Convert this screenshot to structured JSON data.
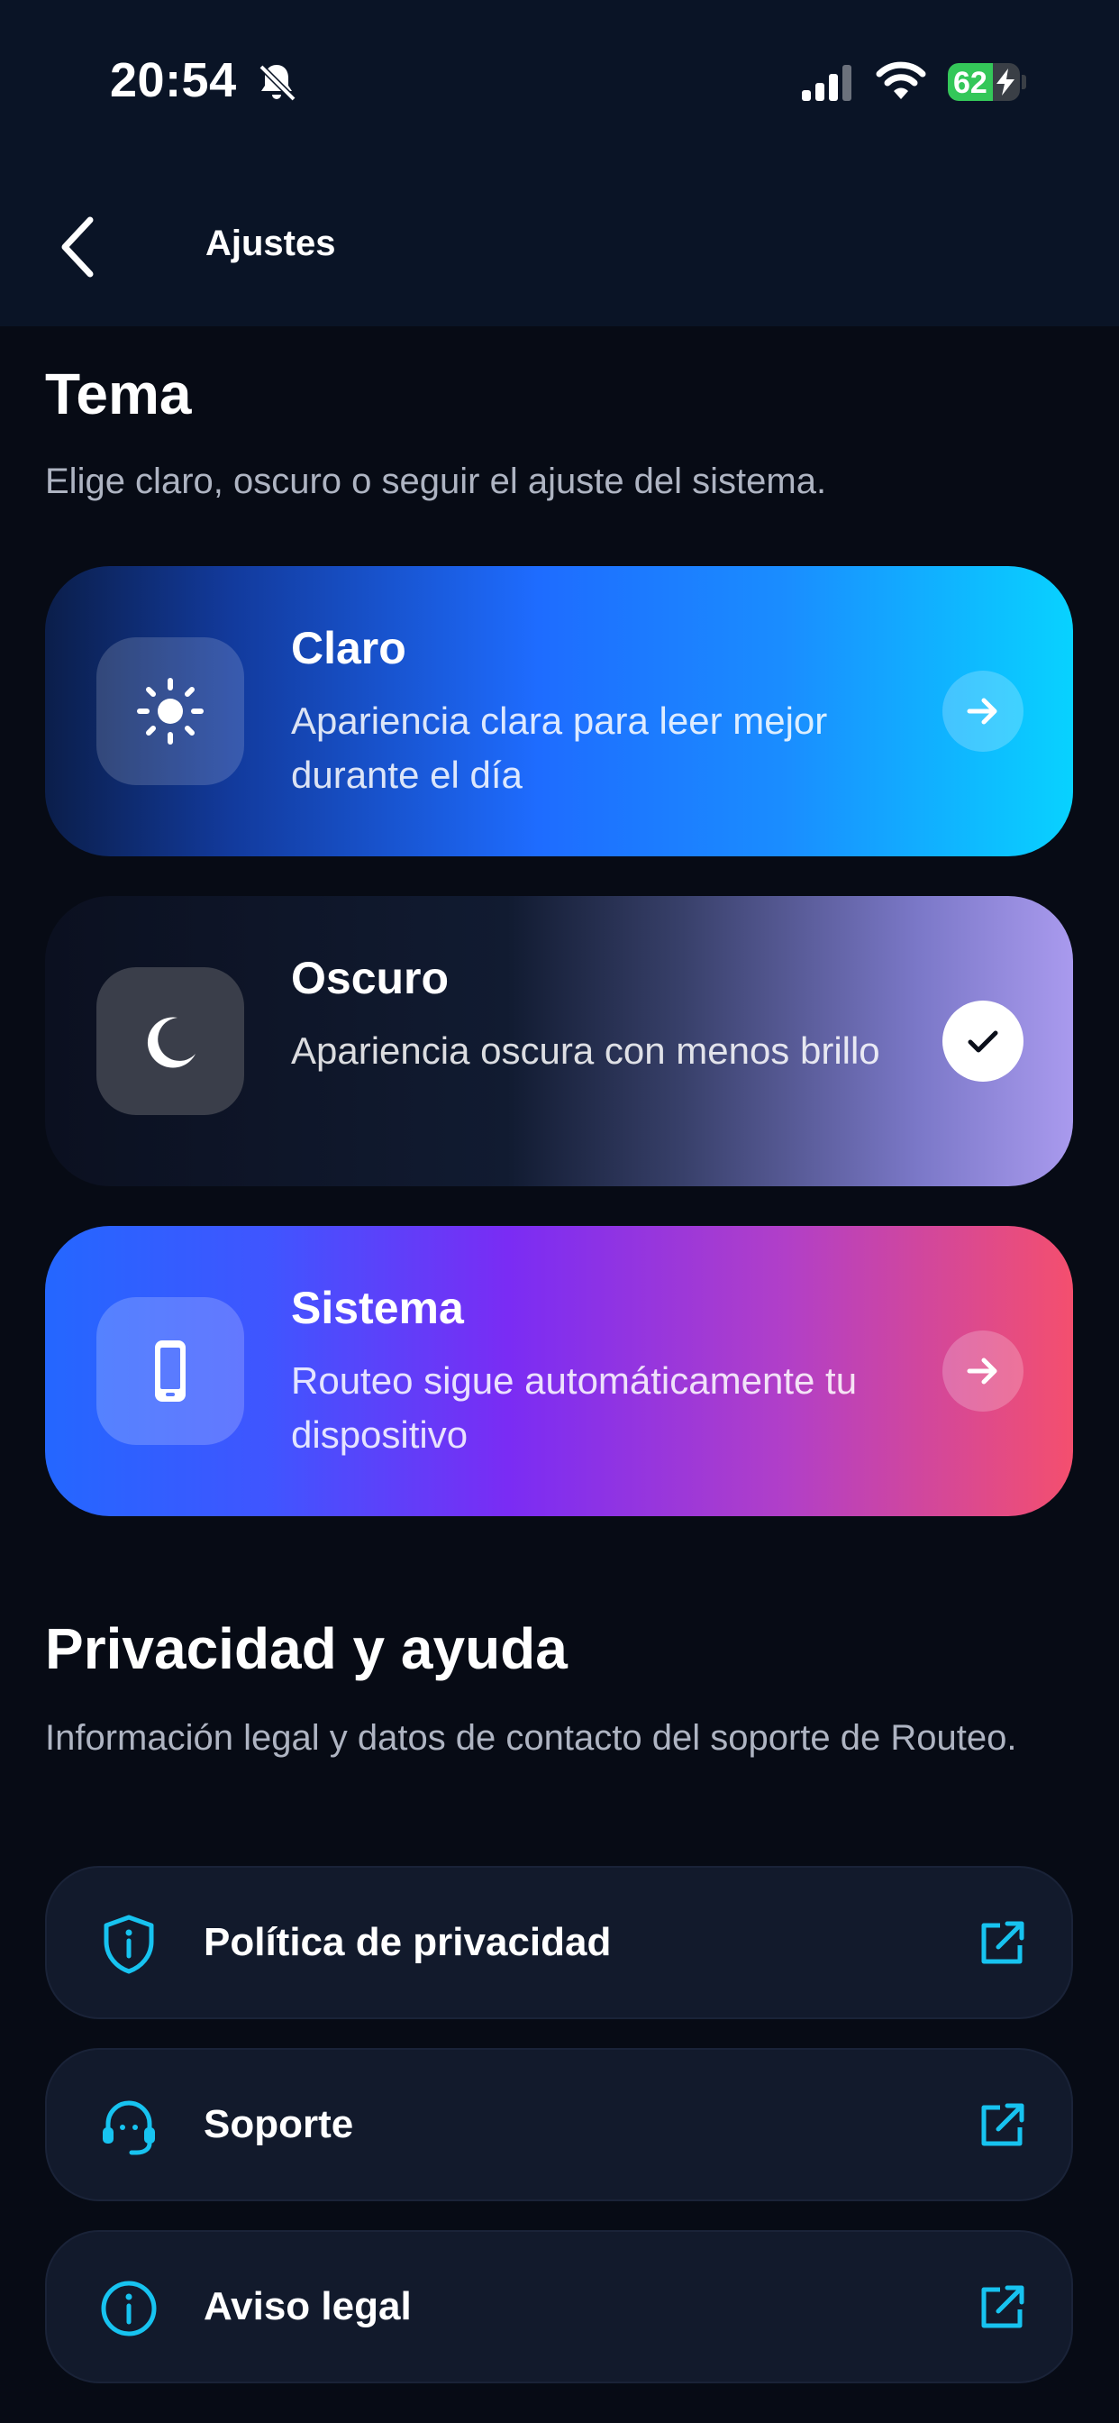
{
  "status_bar": {
    "time": "20:54",
    "battery_level": "62",
    "battery_fraction": 0.62,
    "icons": [
      "bell-slash-icon",
      "signal-icon",
      "wifi-icon",
      "battery-charging-icon"
    ]
  },
  "nav": {
    "title": "Ajustes",
    "back_icon": "chevron-left-icon"
  },
  "theme_section": {
    "title": "Tema",
    "description": "Elige claro, oscuro o seguir el ajuste del sistema.",
    "options": [
      {
        "title": "Claro",
        "description": "Apariencia clara para leer mejor durante el día",
        "icon": "sun-icon",
        "selected": false
      },
      {
        "title": "Oscuro",
        "description": "Apariencia oscura con menos brillo",
        "icon": "moon-icon",
        "selected": true
      },
      {
        "title": "Sistema",
        "description": "Routeo sigue automáticamente tu dispositivo",
        "icon": "phone-icon",
        "selected": false
      }
    ]
  },
  "privacy_section": {
    "title": "Privacidad y ayuda",
    "description": "Información legal y datos de contacto del soporte de Routeo.",
    "links": [
      {
        "label": "Política de privacidad",
        "icon": "shield-info-icon"
      },
      {
        "label": "Soporte",
        "icon": "headset-icon"
      },
      {
        "label": "Aviso legal",
        "icon": "info-circle-icon"
      }
    ]
  },
  "colors": {
    "background": "#070b15",
    "header": "#0a1426",
    "accent_cyan": "#17c3f0",
    "battery_green": "#34c759"
  }
}
